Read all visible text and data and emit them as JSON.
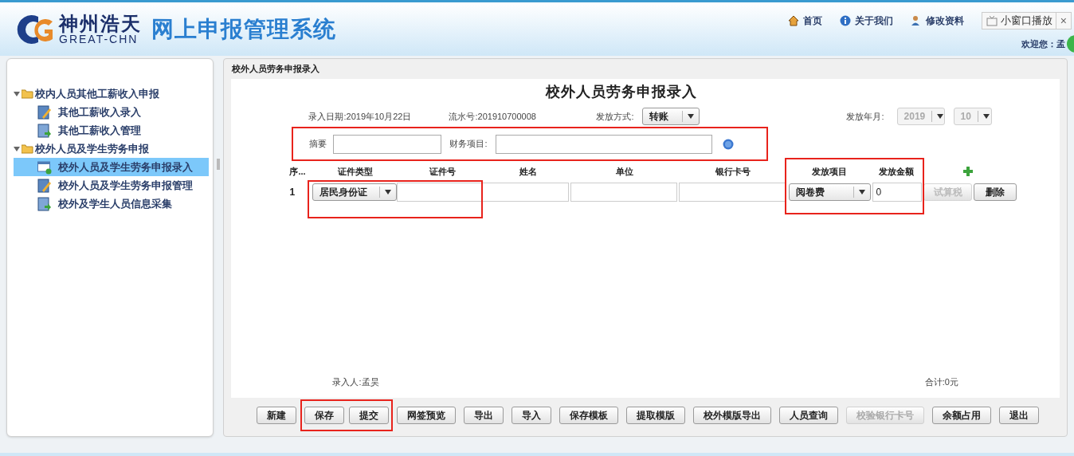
{
  "header": {
    "brand_cn": "神州浩天",
    "brand_en": "GREAT-CHN",
    "system_title": "网上申报管理系统",
    "nav": [
      {
        "label": "首页",
        "kind": "home"
      },
      {
        "label": "关于我们",
        "kind": "info"
      },
      {
        "label": "修改资料",
        "kind": "user"
      }
    ],
    "popup": {
      "label": "小窗口播放",
      "close": "×"
    },
    "welcome": "欢迎您：孟"
  },
  "sidebar": {
    "groups": [
      {
        "label": "校内人员其他工薪收入申报",
        "expanded": true,
        "children": [
          {
            "label": "其他工薪收入录入",
            "kind": "edit",
            "selected": false
          },
          {
            "label": "其他工薪收入管理",
            "kind": "export",
            "selected": false
          }
        ]
      },
      {
        "label": "校外人员及学生劳务申报",
        "expanded": true,
        "children": [
          {
            "label": "校外人员及学生劳务申报录入",
            "kind": "add",
            "selected": true
          },
          {
            "label": "校外人员及学生劳务申报管理",
            "kind": "edit",
            "selected": false
          },
          {
            "label": "校外及学生人员信息采集",
            "kind": "export",
            "selected": false
          }
        ]
      }
    ]
  },
  "panel": {
    "breadcrumb": "校外人员劳务申报录入",
    "title": "校外人员劳务申报录入",
    "entry_date": "录入日期:2019年10月22日",
    "serial": "流水号:201910700008",
    "pay_method": {
      "label": "发放方式:",
      "value": "转账"
    },
    "pay_period": {
      "label": "发放年月:",
      "year": "2019",
      "month": "10",
      "disabled": true
    },
    "summary_row": {
      "highlighted": true,
      "summary_label": "摘要",
      "finance_label": "财务项目:"
    },
    "table": {
      "columns": [
        "序...",
        "证件类型",
        "证件号",
        "姓名",
        "单位",
        "银行卡号",
        "发放项目",
        "发放金额"
      ],
      "highlight_id": true,
      "highlight_pay": true,
      "rows": [
        {
          "index": "1",
          "id_type": "居民身份证",
          "pay_item": "阅卷费",
          "amount": "0",
          "calc": {
            "label": "试算税",
            "disabled": true
          },
          "delete": "删除"
        }
      ]
    },
    "entered_by": "录入人:孟昊",
    "total": "合计:0元"
  },
  "buttons": [
    {
      "label": "新建",
      "disabled": false,
      "highlighted": false
    },
    {
      "label": "保存",
      "disabled": false,
      "highlighted": true
    },
    {
      "label": "提交",
      "disabled": false,
      "highlighted": true
    },
    {
      "label": "网签预览",
      "disabled": false,
      "highlighted": false
    },
    {
      "label": "导出",
      "disabled": false,
      "highlighted": false
    },
    {
      "label": "导入",
      "disabled": false,
      "highlighted": false
    },
    {
      "label": "保存模板",
      "disabled": false,
      "highlighted": false
    },
    {
      "label": "提取模版",
      "disabled": false,
      "highlighted": false
    },
    {
      "label": "校外模版导出",
      "disabled": false,
      "highlighted": false
    },
    {
      "label": "人员查询",
      "disabled": false,
      "highlighted": false
    },
    {
      "label": "校验银行卡号",
      "disabled": true,
      "highlighted": false
    },
    {
      "label": "余额占用",
      "disabled": false,
      "highlighted": false
    },
    {
      "label": "退出",
      "disabled": false,
      "highlighted": false
    }
  ]
}
